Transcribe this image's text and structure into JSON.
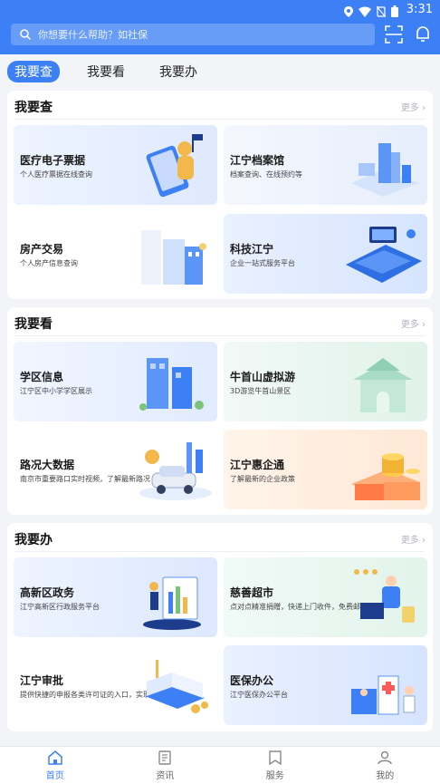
{
  "status": {
    "time": "3:31"
  },
  "search": {
    "placeholder": "你想要什么帮助？如社保"
  },
  "tabs": [
    {
      "label": "我要查",
      "active": true
    },
    {
      "label": "我要看",
      "active": false
    },
    {
      "label": "我要办",
      "active": false
    }
  ],
  "sections": [
    {
      "title": "我要查",
      "more": "更多 ›",
      "tiles": [
        {
          "title": "医疗电子票据",
          "sub": "个人医疗票据在线查询"
        },
        {
          "title": "江宁档案馆",
          "sub": "档案查询、在线预约等"
        },
        {
          "title": "房产交易",
          "sub": "个人房产信息查询"
        },
        {
          "title": "科技江宁",
          "sub": "企业一站式服务平台"
        }
      ]
    },
    {
      "title": "我要看",
      "more": "更多 ›",
      "tiles": [
        {
          "title": "学区信息",
          "sub": "江宁区中小学学区展示"
        },
        {
          "title": "牛首山虚拟游",
          "sub": "3D游览牛首山景区"
        },
        {
          "title": "路况大数据",
          "sub": "南京市重要路口实时视频，了解最新路况"
        },
        {
          "title": "江宁惠企通",
          "sub": "了解最新的企业政策"
        }
      ]
    },
    {
      "title": "我要办",
      "more": "更多 ›",
      "tiles": [
        {
          "title": "高新区政务",
          "sub": "江宁高新区行政服务平台"
        },
        {
          "title": "慈善超市",
          "sub": "点对点精准捐赠，快递上门收件，免费邮寄"
        },
        {
          "title": "江宁审批",
          "sub": "提供快捷的申报各类许可证的入口，实现网上申报"
        },
        {
          "title": "医保办公",
          "sub": "江宁医保办公平台"
        }
      ]
    }
  ],
  "nav": [
    {
      "label": "首页",
      "icon": "home-icon",
      "active": true
    },
    {
      "label": "资讯",
      "icon": "news-icon",
      "active": false
    },
    {
      "label": "服务",
      "icon": "service-icon",
      "active": false
    },
    {
      "label": "我的",
      "icon": "user-icon",
      "active": false
    }
  ],
  "colors": {
    "primary": "#3d80f5",
    "background": "#f2f4f8"
  }
}
